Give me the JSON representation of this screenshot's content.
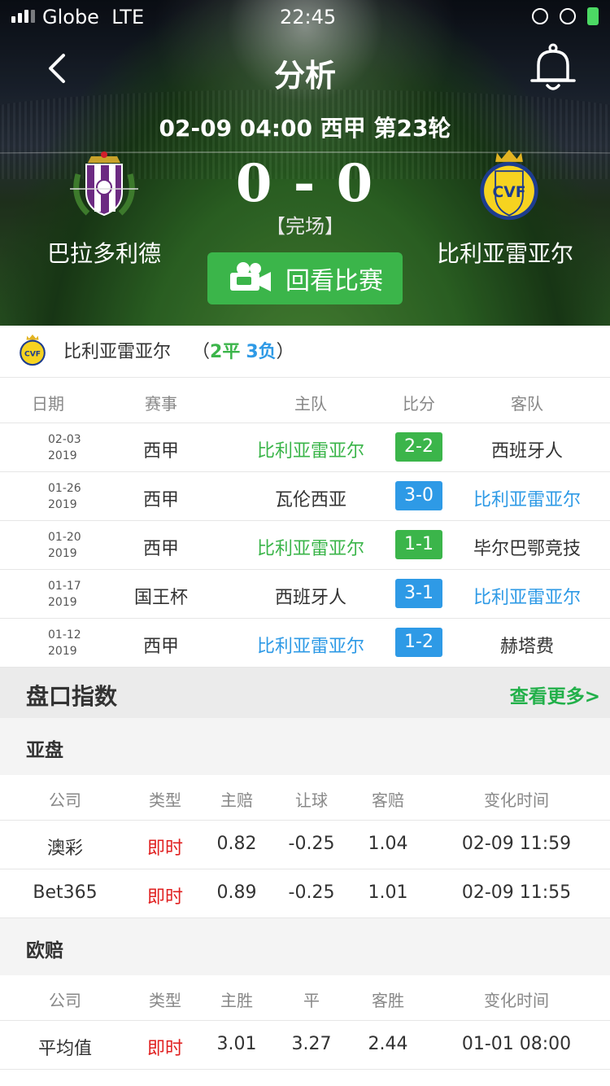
{
  "status_bar": {
    "carrier": "Globe",
    "network": "LTE",
    "time": "22:45"
  },
  "header": {
    "title": "分析",
    "match_info": "02-09 04:00 西甲 第23轮",
    "home_team": "巴拉多利德",
    "away_team": "比利亚雷亚尔",
    "score": "0 - 0",
    "status": "【完场】",
    "replay_label": "回看比赛"
  },
  "recent_form": {
    "team": "比利亚雷亚尔",
    "record_open": "（",
    "draws": "2平",
    "losses": "3负",
    "record_close": "）",
    "columns": [
      "日期",
      "赛事",
      "主队",
      "比分",
      "客队"
    ],
    "rows": [
      {
        "date": "02-03",
        "year": "2019",
        "competition": "西甲",
        "home": "比利亚雷亚尔",
        "score": "2-2",
        "away": "西班牙人",
        "home_color": "green",
        "away_color": "",
        "score_color": "green"
      },
      {
        "date": "01-26",
        "year": "2019",
        "competition": "西甲",
        "home": "瓦伦西亚",
        "score": "3-0",
        "away": "比利亚雷亚尔",
        "home_color": "",
        "away_color": "blue",
        "score_color": "blue"
      },
      {
        "date": "01-20",
        "year": "2019",
        "competition": "西甲",
        "home": "比利亚雷亚尔",
        "score": "1-1",
        "away": "毕尔巴鄂竞技",
        "home_color": "green",
        "away_color": "",
        "score_color": "green"
      },
      {
        "date": "01-17",
        "year": "2019",
        "competition": "国王杯",
        "home": "西班牙人",
        "score": "3-1",
        "away": "比利亚雷亚尔",
        "home_color": "",
        "away_color": "blue",
        "score_color": "blue"
      },
      {
        "date": "01-12",
        "year": "2019",
        "competition": "西甲",
        "home": "比利亚雷亚尔",
        "score": "1-2",
        "away": "赫塔费",
        "home_color": "blue",
        "away_color": "",
        "score_color": "blue"
      }
    ]
  },
  "odds": {
    "title": "盘口指数",
    "more_label": "查看更多>",
    "asian": {
      "title": "亚盘",
      "columns": [
        "公司",
        "类型",
        "主赔",
        "让球",
        "客赔",
        "变化时间"
      ],
      "rows": [
        {
          "company": "澳彩",
          "type": "即时",
          "home": "0.82",
          "handicap": "-0.25",
          "away": "1.04",
          "time": "02-09 11:59"
        },
        {
          "company": "Bet365",
          "type": "即时",
          "home": "0.89",
          "handicap": "-0.25",
          "away": "1.01",
          "time": "02-09 11:55"
        }
      ]
    },
    "european": {
      "title": "欧赔",
      "columns": [
        "公司",
        "类型",
        "主胜",
        "平",
        "客胜",
        "变化时间"
      ],
      "rows": [
        {
          "company": "平均值",
          "type": "即时",
          "home": "3.01",
          "draw": "3.27",
          "away": "2.44",
          "time": "01-01 08:00"
        }
      ]
    }
  },
  "colors": {
    "accent_green": "#3bb54a",
    "accent_blue": "#2e9ae6",
    "live_red": "#e02020"
  }
}
